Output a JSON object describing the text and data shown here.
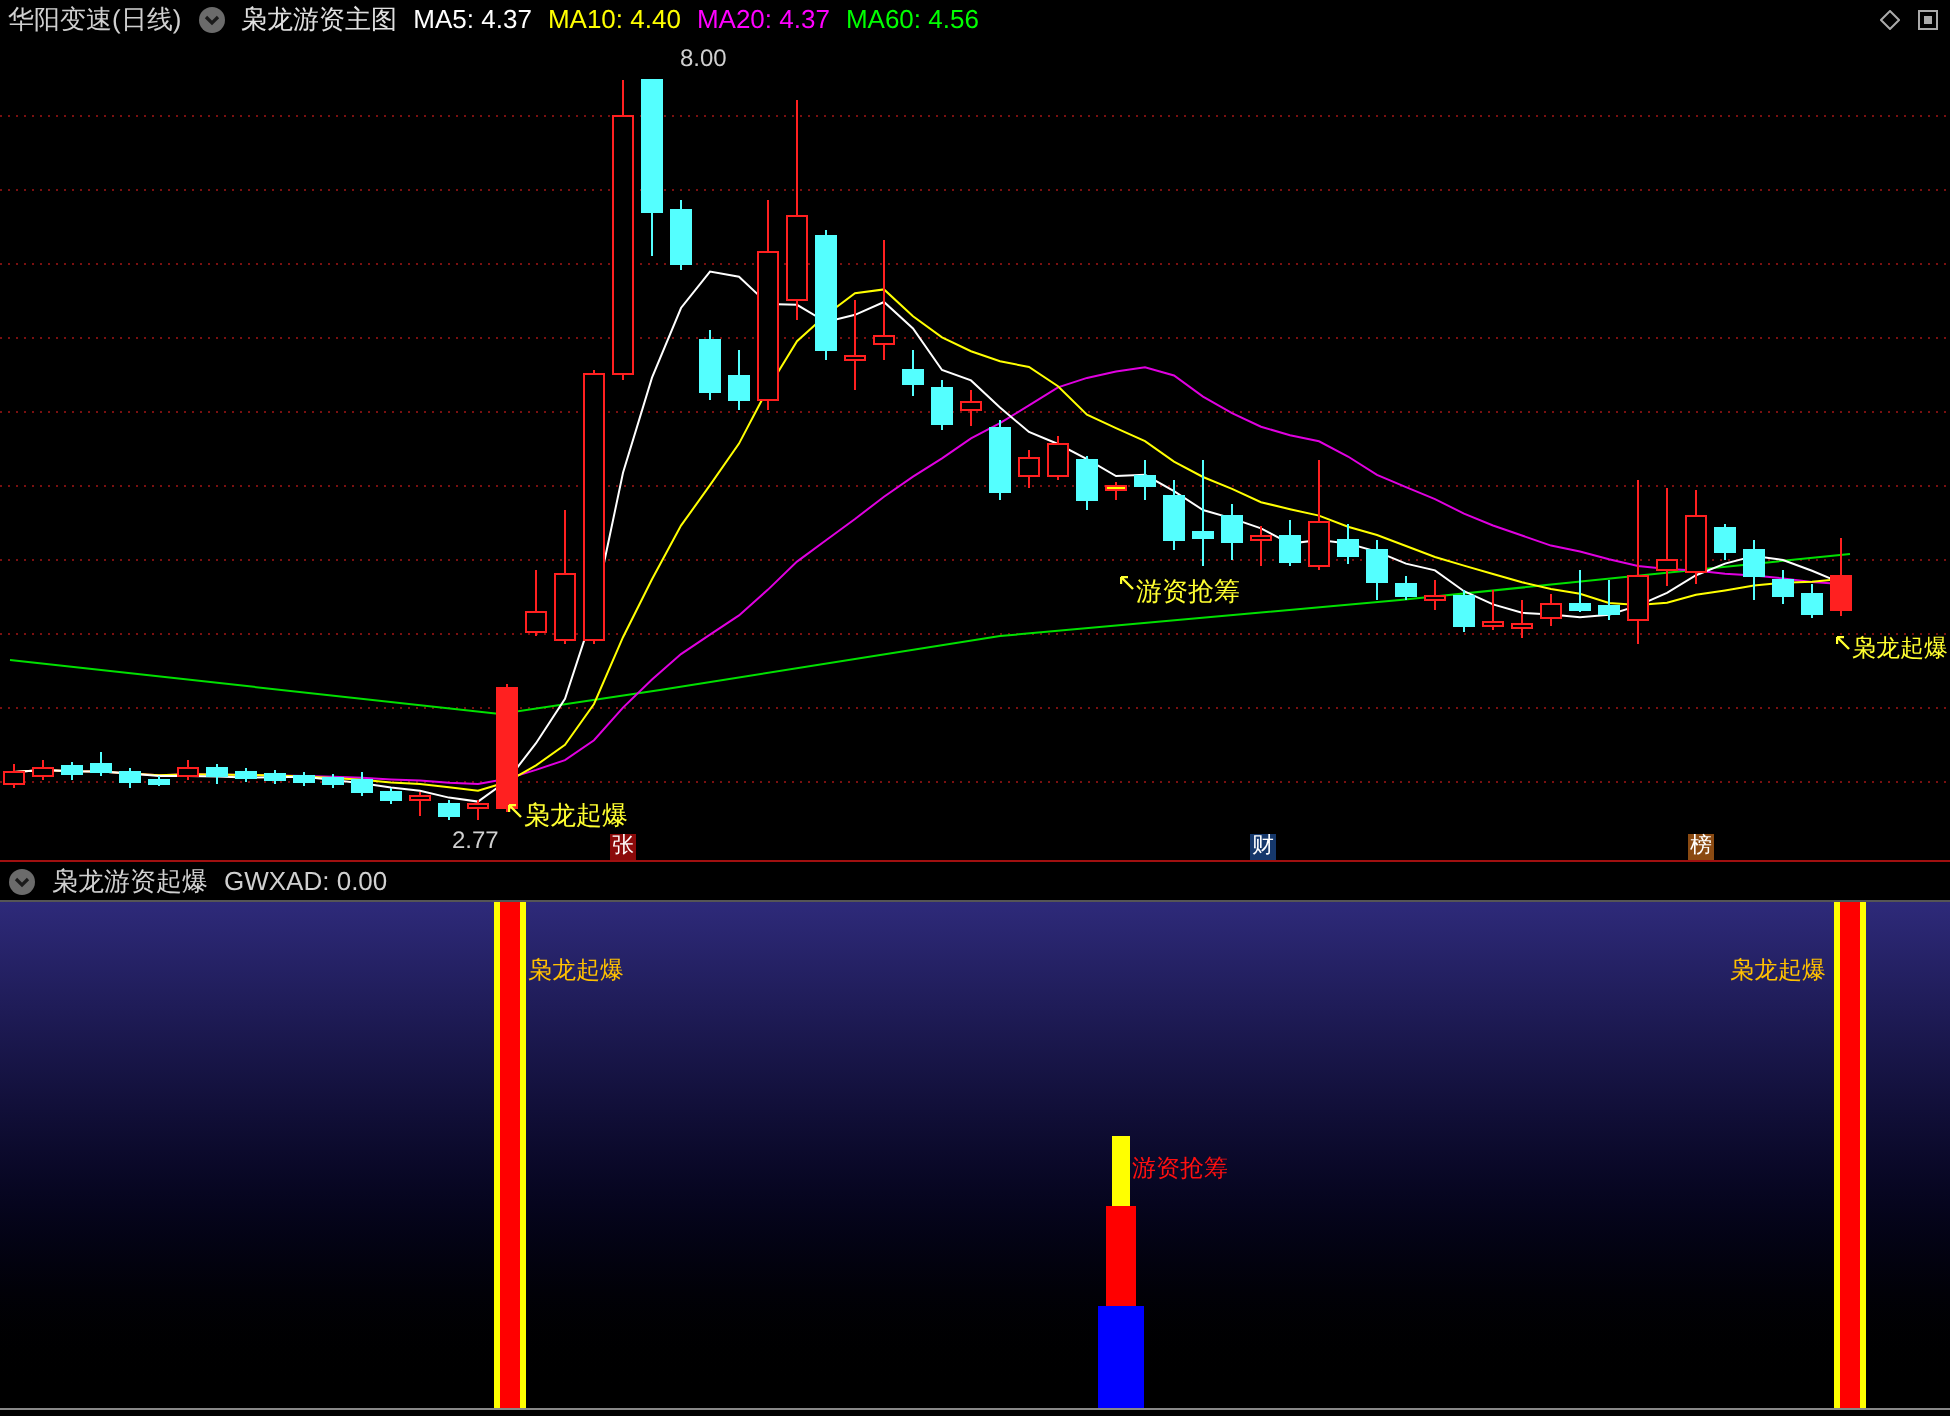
{
  "main_panel": {
    "stock_name": "华阳变速(日线)",
    "indicator": "枭龙游资主图",
    "ma_readings": [
      {
        "label": "MA5: 4.37",
        "color": "#ffffff"
      },
      {
        "label": "MA10: 4.40",
        "color": "#ffff00"
      },
      {
        "label": "MA20: 4.37",
        "color": "#ff00ff"
      },
      {
        "label": "MA60: 4.56",
        "color": "#00ff00"
      }
    ],
    "high_label": "8.00",
    "low_label": "2.77",
    "signals": [
      {
        "label": "枭龙起爆"
      },
      {
        "label": "游资抢筹"
      },
      {
        "label": "枭龙起爆"
      }
    ],
    "event_markers": [
      {
        "text": "张",
        "color": "#8b0a0a"
      },
      {
        "text": "财",
        "color": "#16386b"
      },
      {
        "text": "榜",
        "color": "#8a4a12"
      }
    ]
  },
  "sub_panel": {
    "indicator": "枭龙游资起爆",
    "reading": "GWXAD: 0.00",
    "signals": [
      {
        "kind": "burst",
        "label": "枭龙起爆"
      },
      {
        "kind": "capital",
        "label": "游资抢筹"
      },
      {
        "kind": "burst",
        "label": "枭龙起爆"
      }
    ]
  }
}
